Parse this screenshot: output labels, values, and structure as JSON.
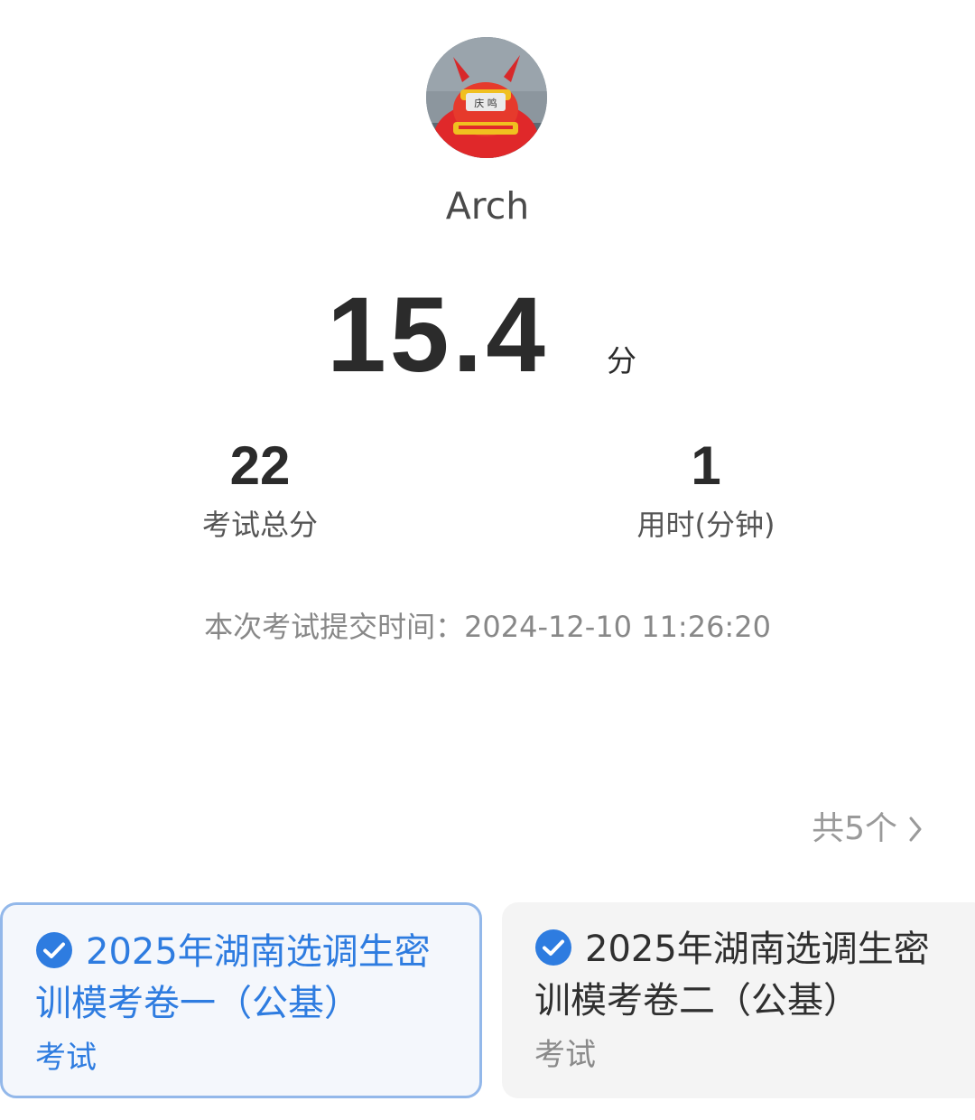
{
  "profile": {
    "username": "Arch",
    "avatar_icon": "red-mascot-avatar"
  },
  "result": {
    "score": "15.4",
    "score_unit": "分"
  },
  "stats": [
    {
      "value": "22",
      "label": "考试总分"
    },
    {
      "value": "1",
      "label": "用时(分钟)"
    }
  ],
  "submit_time": "本次考试提交时间：2024-12-10 11:26:20",
  "exam_list": {
    "more_label": "共5个",
    "more_icon": "chevron-right-icon",
    "accent_color": "#2e7ce0",
    "items": [
      {
        "title": "2025年湖南选调生密训模考卷一（公基）",
        "type": "考试",
        "selected": true,
        "icon": "check-circle-icon"
      },
      {
        "title": "2025年湖南选调生密训模考卷二（公基）",
        "type": "考试",
        "selected": false,
        "icon": "check-circle-icon"
      }
    ]
  }
}
